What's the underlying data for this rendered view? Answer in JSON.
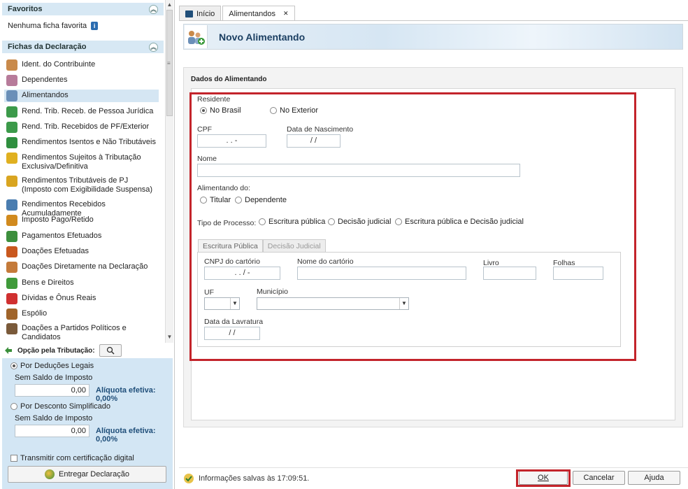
{
  "sidebar": {
    "favoritos_title": "Favoritos",
    "favoritos_empty": "Nenhuma ficha favorita",
    "fichas_title": "Fichas da Declaração",
    "items": [
      {
        "label": "Ident. do Contribuinte",
        "icon": "person-icon",
        "color": "#c98a4b"
      },
      {
        "label": "Dependentes",
        "icon": "dependents-icon",
        "color": "#b77b9a"
      },
      {
        "label": "Alimentandos",
        "icon": "alimentandos-icon",
        "color": "#6a8fb8",
        "selected": true
      },
      {
        "label": "Rend. Trib. Receb. de Pessoa Jurídica",
        "icon": "money-arrow-icon",
        "color": "#3c9a4a"
      },
      {
        "label": "Rend. Trib. Recebidos de PF/Exterior",
        "icon": "money-arrow-icon",
        "color": "#3c9a4a"
      },
      {
        "label": "Rendimentos Isentos e Não Tributáveis",
        "icon": "check-document-icon",
        "color": "#2f8f3f"
      },
      {
        "label": "Rendimentos Sujeitos à Tributação Exclusiva/Definitiva",
        "icon": "warning-icon",
        "color": "#e0b020"
      },
      {
        "label": "Rendimentos Tributáveis de PJ (Imposto com Exigibilidade Suspensa)",
        "icon": "warning-money-icon",
        "color": "#d9a520"
      },
      {
        "label": "Rendimentos Recebidos Acumuladamente",
        "icon": "globe-icon",
        "color": "#4a7db0"
      },
      {
        "label": "Imposto Pago/Retido",
        "icon": "coins-icon",
        "color": "#d18a1e"
      },
      {
        "label": "Pagamentos Efetuados",
        "icon": "card-icon",
        "color": "#3d8f3d"
      },
      {
        "label": "Doações Efetuadas",
        "icon": "wallet-icon",
        "color": "#c9581e"
      },
      {
        "label": "Doações Diretamente na Declaração",
        "icon": "donation-icon",
        "color": "#c47a3a"
      },
      {
        "label": "Bens e Direitos",
        "icon": "money-bag-icon",
        "color": "#3f9a3a"
      },
      {
        "label": "Dívidas e Ônus Reais",
        "icon": "arrow-down-icon",
        "color": "#d03030"
      },
      {
        "label": "Espólio",
        "icon": "chest-icon",
        "color": "#a0642a"
      },
      {
        "label": "Doações a Partidos Políticos e Candidatos",
        "icon": "person-tie-icon",
        "color": "#7a5a3a"
      }
    ]
  },
  "tax": {
    "opcao_label": "Opção pela Tributação:",
    "deducoes_label": "Por Deduções Legais",
    "saldo1_label": "Sem Saldo de Imposto",
    "saldo1_value": "0,00",
    "aliquota1": "Alíquota efetiva: 0,00%",
    "simplificado_label": "Por Desconto Simplificado",
    "saldo2_label": "Sem Saldo de Imposto",
    "saldo2_value": "0,00",
    "aliquota2": "Alíquota efetiva: 0,00%",
    "transmitir_label": "Transmitir com certificação digital",
    "entregar_label": "Entregar Declaração"
  },
  "tabs": [
    {
      "label": "Início"
    },
    {
      "label": "Alimentandos"
    }
  ],
  "banner": {
    "title": "Novo Alimentando"
  },
  "form": {
    "section_title": "Dados do Alimentando",
    "residente_label": "Residente",
    "no_brasil": "No Brasil",
    "no_exterior": "No Exterior",
    "cpf_label": "CPF",
    "cpf_value": ". . -",
    "nascimento_label": "Data de Nascimento",
    "nascimento_value": "/ /",
    "nome_label": "Nome",
    "alimentando_do_label": "Alimentando do:",
    "titular": "Titular",
    "dependente": "Dependente",
    "tipo_processo_label": "Tipo de Processo:",
    "escritura_publica": "Escritura pública",
    "decisao_judicial": "Decisão judicial",
    "escritura_e_decisao": "Escritura pública e Decisão judicial",
    "subtab_escritura": "Escritura Pública",
    "subtab_decisao": "Decisão Judicial",
    "cnpj_label": "CNPJ do cartório",
    "cnpj_value": ". . / -",
    "nome_cartorio_label": "Nome do cartório",
    "livro_label": "Livro",
    "folhas_label": "Folhas",
    "uf_label": "UF",
    "municipio_label": "Município",
    "lavratura_label": "Data da Lavratura",
    "lavratura_value": "/ /"
  },
  "footer": {
    "status": "Informações salvas às 17:09:51.",
    "ok": "OK",
    "cancelar": "Cancelar",
    "ajuda": "Ajuda"
  },
  "colors": {
    "accent_red": "#c3242b",
    "header_blue": "#d7e8f4",
    "title_blue": "#1b3f62"
  }
}
